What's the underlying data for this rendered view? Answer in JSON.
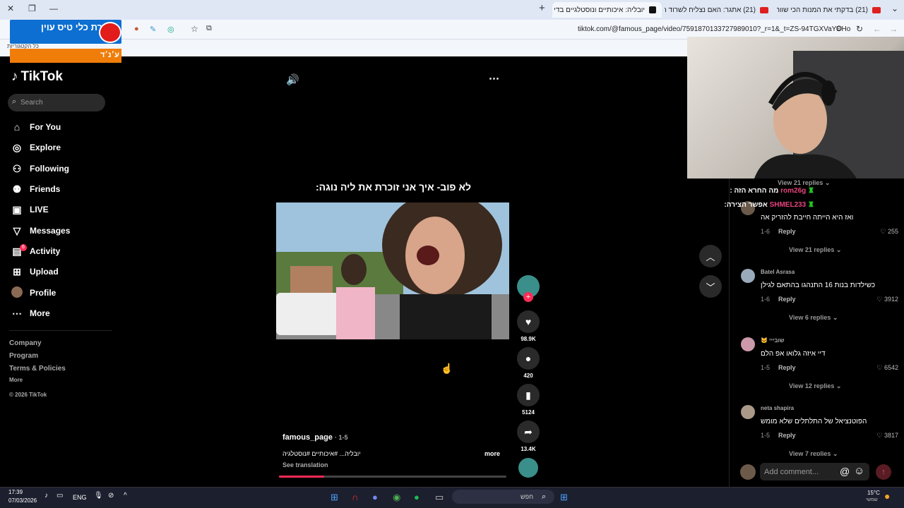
{
  "browser": {
    "url": "tiktok.com/@famous_page/video/7591870133727989010?_r=1&_t=ZS-94TGXVaYDHo",
    "tabs": [
      {
        "title": "(21) בדקתי את המנות הכי שווה",
        "icon": "youtube-icon"
      },
      {
        "title": "(21) אתגר: האם נצליח לשרוד ר",
        "icon": "youtube-icon"
      },
      {
        "title": "יובליה: איכותיים ונוסטלגיים בדי",
        "icon": "tiktok-icon"
      }
    ]
  },
  "stream_overlay": {
    "banner_text": "חדירת כלי טיס עוין",
    "orange_text": "ע׳נ׳ד",
    "label": "כל הקטגוריות"
  },
  "sidebar": {
    "logo": "TikTok",
    "search_placeholder": "Search",
    "items": [
      {
        "label": "For You",
        "icon": "home-icon"
      },
      {
        "label": "Explore",
        "icon": "compass-icon"
      },
      {
        "label": "Following",
        "icon": "following-icon"
      },
      {
        "label": "Friends",
        "icon": "friends-icon"
      },
      {
        "label": "LIVE",
        "icon": "live-icon"
      },
      {
        "label": "Messages",
        "icon": "send-icon"
      },
      {
        "label": "Activity",
        "icon": "bell-icon",
        "badge": "6"
      },
      {
        "label": "Upload",
        "icon": "plus-square-icon"
      },
      {
        "label": "Profile",
        "icon": "avatar-icon"
      },
      {
        "label": "More",
        "icon": "ellipsis-icon"
      }
    ],
    "footer": {
      "company": "Company",
      "program": "Program",
      "terms": "Terms & Policies",
      "more": "More",
      "copyright": "© 2026 TikTok"
    }
  },
  "video": {
    "caption": "לא פוב- איך אני זוכרת את ליה נוגה:",
    "author": "famous_page",
    "date": "1-5",
    "tags": "יובליה... #איכותיים #נוסטלגיה",
    "more": "more",
    "see_translation": "See translation",
    "progress": 0.2
  },
  "actions": {
    "likes": "98.9K",
    "comments": "420",
    "saves": "5124",
    "shares": "13.4K"
  },
  "chat": [
    {
      "user": "rom26g",
      "text": "מה החרא הזה :"
    },
    {
      "user": "SHMEL233",
      "text": "אפשר הצירה:"
    }
  ],
  "comments": {
    "view_replies_top": "View 21 replies",
    "list": [
      {
        "name": "",
        "text": "ואז היא הייתה חייבת להזריק אה",
        "date": "1-6",
        "likes": "255",
        "replies": "View 21 replies"
      },
      {
        "name": "Batel Asrasa",
        "text": "כשילדות בנות 16 התנהגו בהתאם לגילן",
        "date": "1-6",
        "likes": "3912",
        "replies": "View 6 replies"
      },
      {
        "name": "שובייי 🐱",
        "text": "דיי איזה גלואו אפ הלם",
        "date": "1-5",
        "likes": "6542",
        "replies": "View 12 replies"
      },
      {
        "name": "neta shapira",
        "text": "הפוטנציאל של התלתלים שלא מומש",
        "date": "1-5",
        "likes": "3817",
        "replies": "View 7 replies"
      }
    ],
    "reply_label": "Reply",
    "add_placeholder": "Add comment..."
  },
  "taskbar": {
    "time": "17:39",
    "date": "07/03/2026",
    "lang": "ENG",
    "search": "חפש",
    "temp": "15°C",
    "weather": "שמשי"
  }
}
